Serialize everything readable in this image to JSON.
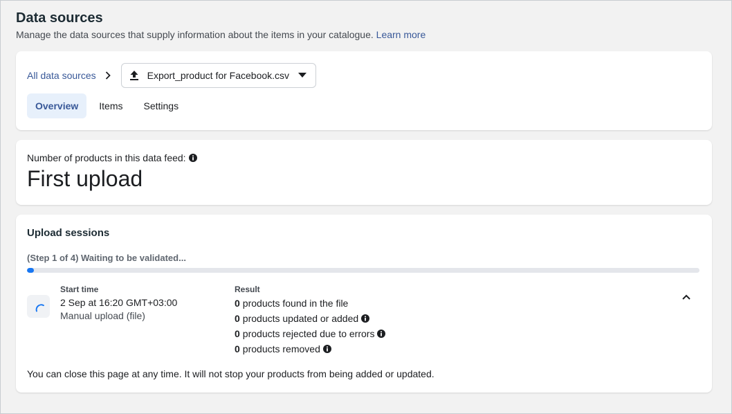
{
  "header": {
    "title": "Data sources",
    "subtitle": "Manage the data sources that supply information about the items in your catalogue.",
    "learn_more": "Learn more"
  },
  "breadcrumb": {
    "all_label": "All data sources",
    "selected_source": "Export_product for Facebook.csv",
    "source_icon": "upload-icon"
  },
  "tabs": [
    {
      "label": "Overview",
      "active": true
    },
    {
      "label": "Items",
      "active": false
    },
    {
      "label": "Settings",
      "active": false
    }
  ],
  "product_count": {
    "label": "Number of products in this data feed:",
    "value": "First upload"
  },
  "upload_sessions": {
    "title": "Upload sessions",
    "step_text": "(Step 1 of 4) Waiting to be validated...",
    "progress_fraction": 0.01,
    "start_time_label": "Start time",
    "start_time": "2 Sep at 16:20 GMT+03:00",
    "upload_type": "Manual upload (file)",
    "result_label": "Result",
    "results": [
      {
        "count": "0",
        "text": "products found in the file",
        "info": false
      },
      {
        "count": "0",
        "text": "products updated or added",
        "info": true
      },
      {
        "count": "0",
        "text": "products rejected due to errors",
        "info": true
      },
      {
        "count": "0",
        "text": "products removed",
        "info": true
      }
    ],
    "footnote": "You can close this page at any time. It will not stop your products from being added or updated."
  },
  "colors": {
    "link": "#385898",
    "progress_fill": "#1877f2",
    "tab_active_bg": "#e7f0fb"
  }
}
